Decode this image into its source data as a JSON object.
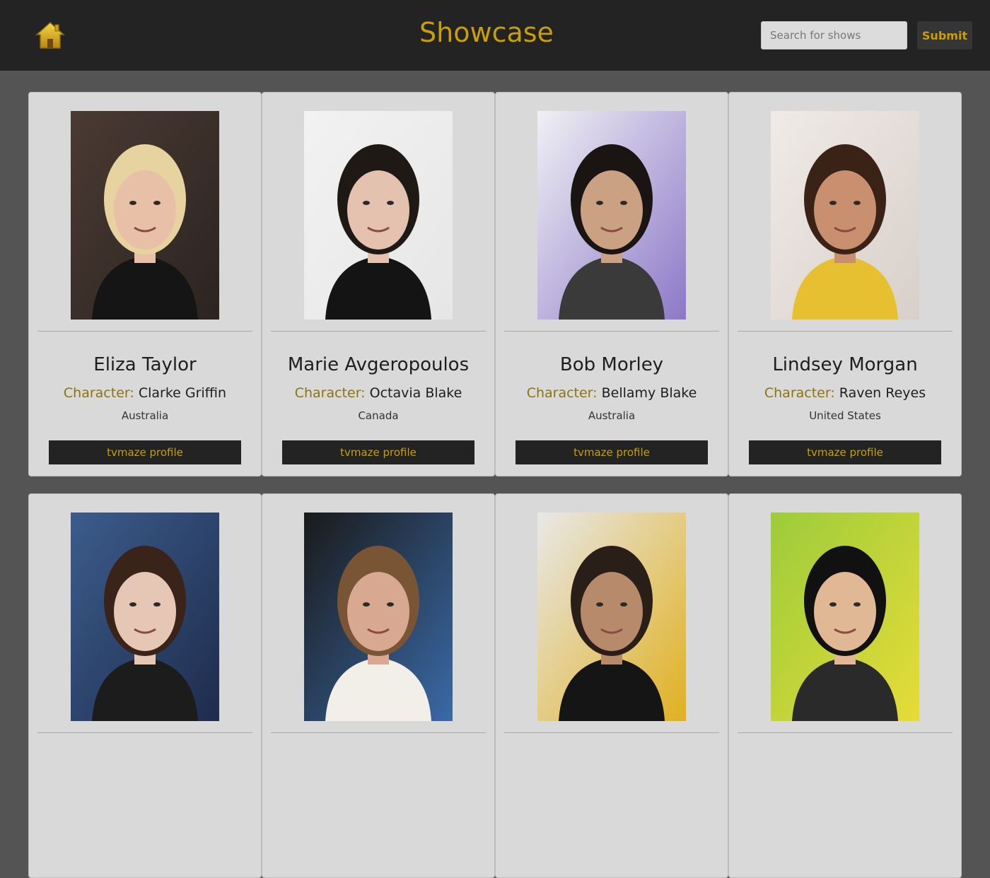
{
  "header": {
    "title": "Showcase",
    "home_icon": "home-icon",
    "search_placeholder": "Search for shows",
    "search_value": "",
    "submit_label": "Submit"
  },
  "colors": {
    "accent": "#c9a000",
    "navbar": "#232323",
    "page": "#545454",
    "card": "#d9d9d9"
  },
  "cast": [
    {
      "name": "Eliza Taylor",
      "character_label": "Character:",
      "character": "Clarke Griffin",
      "country": "Australia",
      "link_label": "tvmaze profile",
      "photo": {
        "bg1": "#4a3a33",
        "bg2": "#2c2420",
        "skin": "#e8c0a8",
        "hair": "#e6d3a0",
        "shirt": "#151515"
      }
    },
    {
      "name": "Marie Avgeropoulos",
      "character_label": "Character:",
      "character": "Octavia Blake",
      "country": "Canada",
      "link_label": "tvmaze profile",
      "photo": {
        "bg1": "#f2f2f2",
        "bg2": "#e6e6e6",
        "skin": "#e5c2b0",
        "hair": "#1f1915",
        "shirt": "#141414"
      }
    },
    {
      "name": "Bob Morley",
      "character_label": "Character:",
      "character": "Bellamy Blake",
      "country": "Australia",
      "link_label": "tvmaze profile",
      "photo": {
        "bg1": "#f0f0f4",
        "bg2": "#8c78c8",
        "skin": "#caa183",
        "hair": "#1a1512",
        "shirt": "#3a3a3a"
      }
    },
    {
      "name": "Lindsey Morgan",
      "character_label": "Character:",
      "character": "Raven Reyes",
      "country": "United States",
      "link_label": "tvmaze profile",
      "photo": {
        "bg1": "#f0ebe8",
        "bg2": "#d8cfc8",
        "skin": "#c8906e",
        "hair": "#3a2216",
        "shirt": "#e6c030"
      }
    },
    {
      "name": "",
      "character_label": "",
      "character": "",
      "country": "",
      "link_label": "",
      "photo": {
        "bg1": "#3c5c8c",
        "bg2": "#1e2c4c",
        "skin": "#e6c7b5",
        "hair": "#3a2318",
        "shirt": "#1c1c1c"
      }
    },
    {
      "name": "",
      "character_label": "",
      "character": "",
      "country": "",
      "link_label": "",
      "photo": {
        "bg1": "#1a1a1a",
        "bg2": "#3a6aa8",
        "skin": "#d8a890",
        "hair": "#7a5535",
        "shirt": "#f2efe8"
      }
    },
    {
      "name": "",
      "character_label": "",
      "character": "",
      "country": "",
      "link_label": "",
      "photo": {
        "bg1": "#e8e8e8",
        "bg2": "#e0b020",
        "skin": "#b88a6c",
        "hair": "#2a1e18",
        "shirt": "#151515"
      }
    },
    {
      "name": "",
      "character_label": "",
      "character": "",
      "country": "",
      "link_label": "",
      "photo": {
        "bg1": "#9ccc3a",
        "bg2": "#e6dc38",
        "skin": "#e0b896",
        "hair": "#111111",
        "shirt": "#2a2a2a"
      }
    }
  ]
}
